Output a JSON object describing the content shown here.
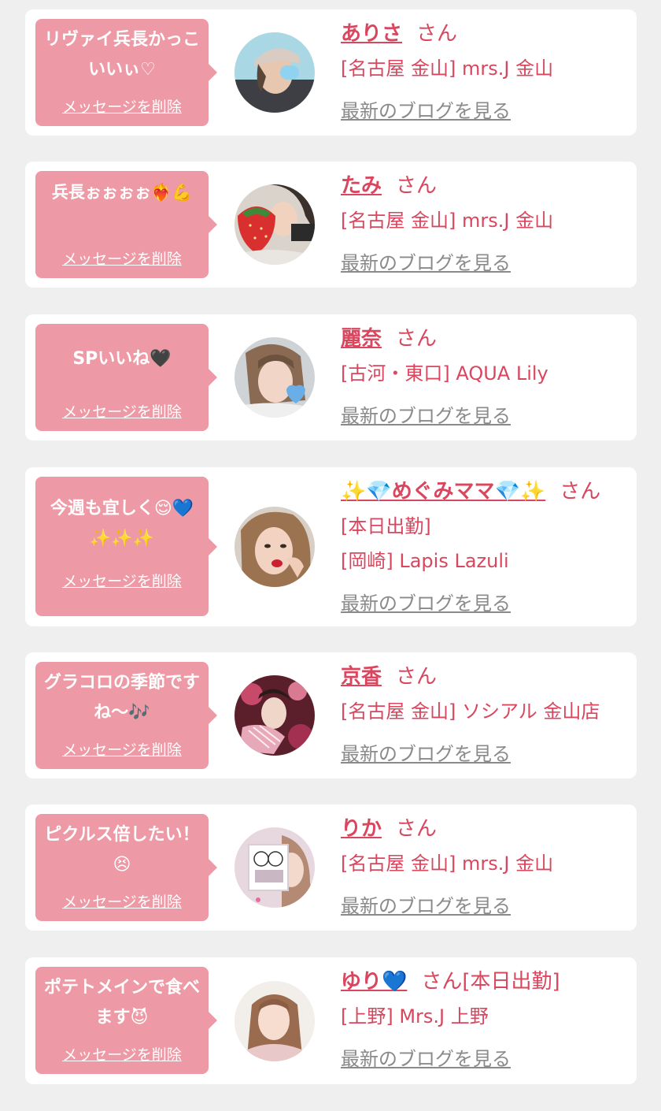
{
  "delete_label": "メッセージを削除",
  "blog_label": "最新のブログを見る",
  "san_label": "さん",
  "colors": {
    "background": "#f0eff0",
    "card": "#ffffff",
    "bubble": "#ee9aa6",
    "name_pink": "#d9475f",
    "blog_gray": "#8a8a8a"
  },
  "messages": [
    {
      "bubble_text": "リヴァイ兵長かっこいいぃ♡",
      "name": "ありさ",
      "san": "さん",
      "shop": "[名古屋 金山] mrs.J 金山",
      "avatar_icon": "woman-with-cap-photo"
    },
    {
      "bubble_text": "兵長ぉぉぉぉ❤️‍🔥💪",
      "name": "たみ",
      "san": "さん",
      "shop": "[名古屋 金山] mrs.J 金山",
      "avatar_icon": "woman-with-strawberry-photo"
    },
    {
      "bubble_text": "SPいいね🖤",
      "name": "麗奈",
      "san": "さん",
      "shop": "[古河・東口] AQUA Lily",
      "avatar_icon": "woman-with-heart-sticker-photo"
    },
    {
      "bubble_text": "今週も宜しく😌💙✨✨✨",
      "name": "✨💎めぐみママ💎✨",
      "san": "さん",
      "status": "[本日出勤]",
      "shop": "[岡崎] Lapis Lazuli",
      "avatar_icon": "woman-selfie-photo"
    },
    {
      "bubble_text": "グラコロの季節ですね〜🎶",
      "name": "京香",
      "san": "さん",
      "shop": "[名古屋 金山] ソシアル 金山店",
      "avatar_icon": "woman-in-kimono-photo"
    },
    {
      "bubble_text": "ピクルス倍したい！😣",
      "name": "りか",
      "san": "さん",
      "shop": "[名古屋 金山] mrs.J 金山",
      "avatar_icon": "woman-with-sticker-photo"
    },
    {
      "bubble_text": "ポテトメインで食べます😈",
      "name": "ゆり💙",
      "san": "さん[本日出勤]",
      "shop": "[上野] Mrs.J 上野",
      "avatar_icon": "woman-portrait-photo"
    }
  ]
}
